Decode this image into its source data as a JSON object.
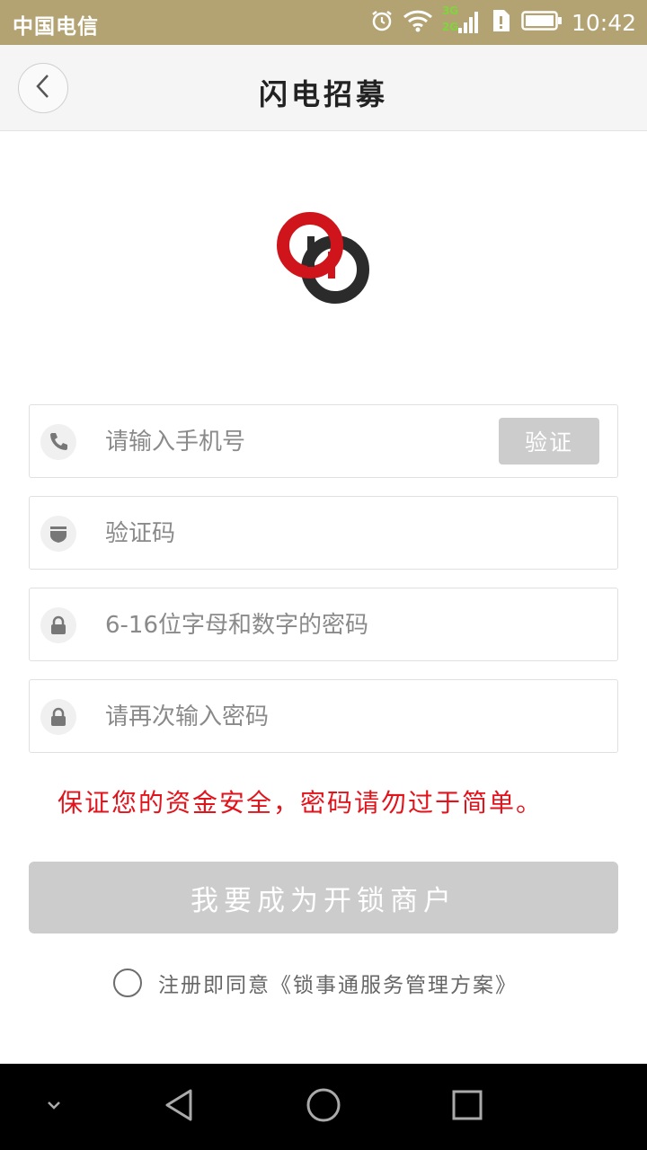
{
  "status_bar": {
    "carrier": "中国电信",
    "network_top": "3G",
    "network_bottom": "2G",
    "time": "10:42"
  },
  "header": {
    "title": "闪电招募",
    "back_icon": "chevron-left-icon"
  },
  "form": {
    "phone": {
      "placeholder": "请输入手机号",
      "icon": "phone-icon",
      "verify_label": "验证"
    },
    "code": {
      "placeholder": "验证码",
      "icon": "shield-icon"
    },
    "password": {
      "placeholder": "6-16位字母和数字的密码",
      "icon": "lock-icon"
    },
    "confirm": {
      "placeholder": "请再次输入密码",
      "icon": "lock-icon"
    },
    "warning": "保证您的资金安全，密码请勿过于简单。",
    "submit_label": "我要成为开锁商户",
    "agreement": "注册即同意《锁事通服务管理方案》"
  },
  "colors": {
    "status_bar": "#b3a373",
    "warning": "#e2131b",
    "disabled_button": "#cccccc",
    "logo_red": "#d0141b",
    "logo_dark": "#2b2b2b"
  },
  "nav": {
    "items": [
      "chevron-down-icon",
      "back-triangle-icon",
      "home-circle-icon",
      "recents-square-icon"
    ]
  }
}
